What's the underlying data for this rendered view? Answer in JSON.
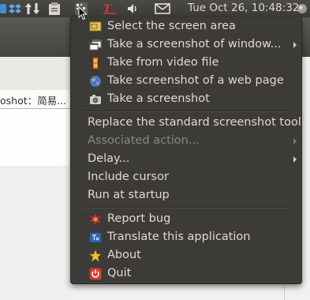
{
  "panel": {
    "clock": "Tue Oct 26, 10:48:32",
    "icons": [
      "dropbox-icon",
      "transfer-icon",
      "clipboard-icon",
      "screenshot-tool-icon",
      "text-tool-icon",
      "volume-icon",
      "mail-icon",
      "power-icon"
    ]
  },
  "background": {
    "tab_text": "oshot：简易..."
  },
  "menu": {
    "items": [
      {
        "label": "Select the screen area",
        "icon": "select-area-icon"
      },
      {
        "label": "Take a screenshot of window...",
        "icon": "window-icon",
        "submenu": true
      },
      {
        "label": "Take from video file",
        "icon": "film-icon"
      },
      {
        "label": "Take screenshot of a web page",
        "icon": "globe-icon"
      },
      {
        "label": "Take a screenshot",
        "icon": "camera-icon"
      },
      {
        "label": "Replace the standard screenshot tool"
      },
      {
        "label": "Associated action...",
        "submenu": true,
        "disabled": true
      },
      {
        "label": "Delay...",
        "submenu": true
      },
      {
        "label": "Include cursor"
      },
      {
        "label": "Run at startup"
      },
      {
        "label": "Report bug",
        "icon": "bug-icon"
      },
      {
        "label": "Translate this application",
        "icon": "translate-icon"
      },
      {
        "label": "About",
        "icon": "star-icon"
      },
      {
        "label": "Quit",
        "icon": "quit-icon"
      }
    ]
  },
  "colors": {
    "menu_bg": "#3c3b37",
    "menu_text": "#dfdbd2",
    "disabled_text": "#8a8883",
    "quit_red": "#d83a2a"
  }
}
